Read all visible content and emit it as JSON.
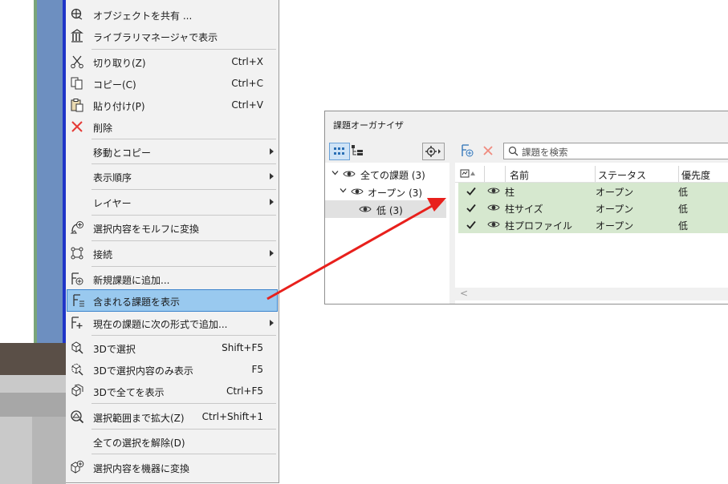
{
  "context_menu": {
    "items": [
      {
        "label": "オブジェクトを共有 ...",
        "icon": "share-object-icon"
      },
      {
        "label": "ライブラリマネージャで表示",
        "icon": "library-manager-icon"
      },
      {
        "label": "切り取り(Z)",
        "shortcut": "Ctrl+X",
        "icon": "scissors-icon"
      },
      {
        "label": "コピー(C)",
        "shortcut": "Ctrl+C",
        "icon": "copy-icon"
      },
      {
        "label": "貼り付け(P)",
        "shortcut": "Ctrl+V",
        "icon": "paste-icon"
      },
      {
        "label": "削除",
        "icon": "delete-x-icon"
      },
      {
        "label": "移動とコピー",
        "submenu": true
      },
      {
        "label": "表示順序",
        "submenu": true
      },
      {
        "label": "レイヤー",
        "submenu": true
      },
      {
        "label": "選択内容をモルフに変換",
        "icon": "morph-convert-icon"
      },
      {
        "label": "接続",
        "submenu": true,
        "icon": "connect-icon"
      },
      {
        "label": "新規課題に追加...",
        "icon": "new-issue-icon"
      },
      {
        "label": "含まれる課題を表示",
        "icon": "show-issues-icon",
        "highlighted": true
      },
      {
        "label": "現在の課題に次の形式で追加...",
        "submenu": true,
        "icon": "add-to-issue-icon"
      },
      {
        "label": "3Dで選択",
        "shortcut": "Shift+F5",
        "icon": "select-3d-icon"
      },
      {
        "label": "3Dで選択内容のみ表示",
        "shortcut": "F5",
        "icon": "show-selection-3d-icon"
      },
      {
        "label": "3Dで全てを表示",
        "shortcut": "Ctrl+F5",
        "icon": "show-all-3d-icon"
      },
      {
        "label": "選択範囲まで拡大(Z)",
        "shortcut": "Ctrl+Shift+1",
        "icon": "zoom-selection-icon"
      },
      {
        "label": "全ての選択を解除(D)"
      },
      {
        "label": "選択内容を機器に変換",
        "icon": "equipment-convert-icon"
      }
    ]
  },
  "issue_organizer": {
    "title": "課題オーガナイザ",
    "tree": [
      {
        "label": "全ての課題 (3)"
      },
      {
        "label": "オープン (3)"
      },
      {
        "label": "低 (3)"
      }
    ],
    "search": {
      "placeholder": "課題を検索"
    },
    "columns": {
      "name": "名前",
      "status": "ステータス",
      "priority": "優先度"
    },
    "rows": [
      {
        "name": "柱",
        "status": "オープン",
        "priority": "低"
      },
      {
        "name": "柱サイズ",
        "status": "オープン",
        "priority": "低"
      },
      {
        "name": "柱プロファイル",
        "status": "オープン",
        "priority": "低"
      }
    ],
    "scroll_left": "<"
  },
  "colors": {
    "menu_highlight": "#99c9ef",
    "row_highlight": "#d6e8cf",
    "annotation_arrow": "#e8201c"
  }
}
